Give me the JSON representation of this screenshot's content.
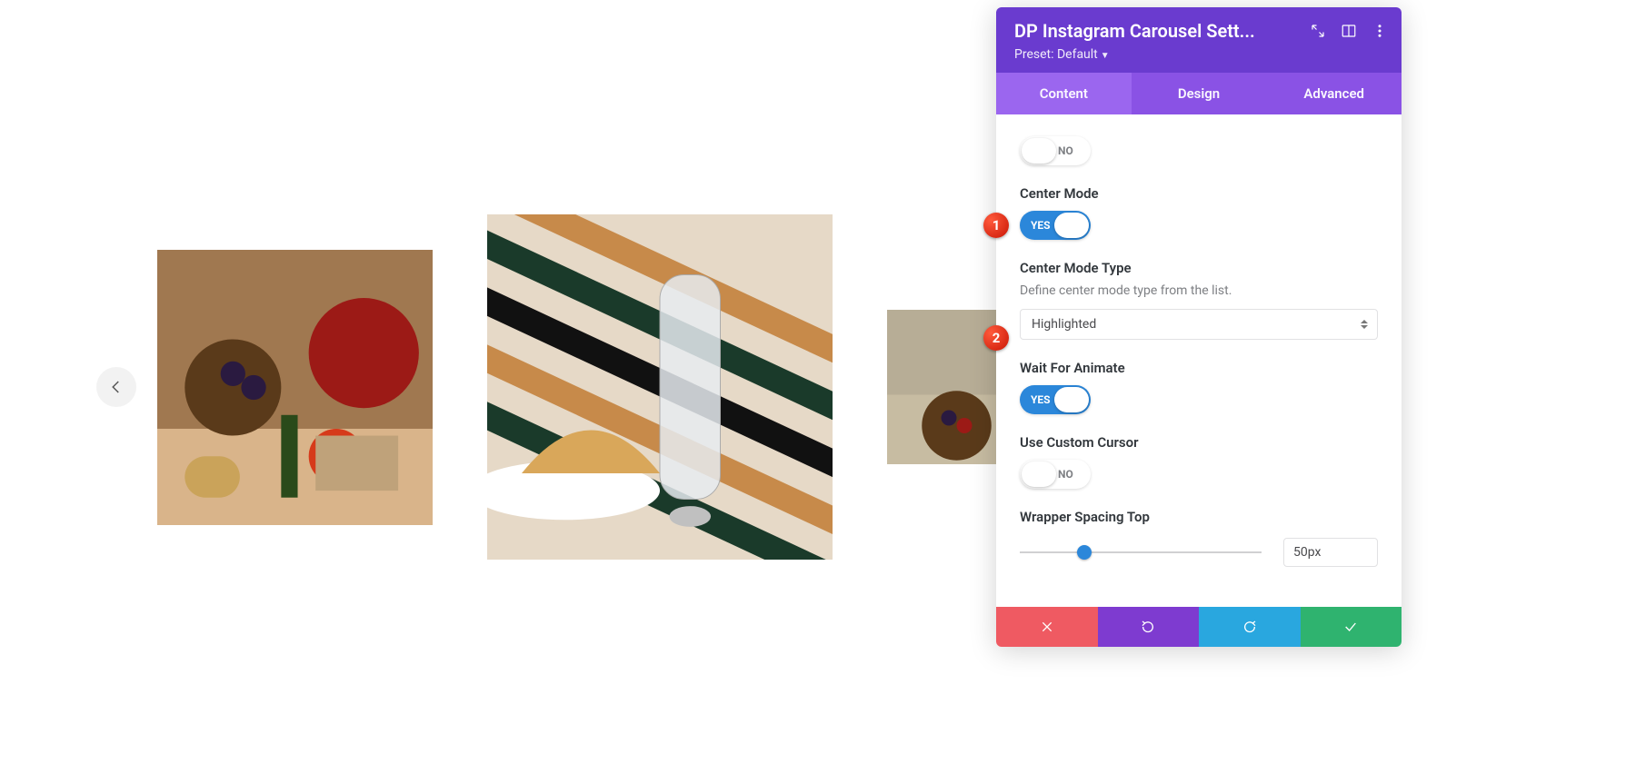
{
  "panel": {
    "title": "DP Instagram Carousel Sett...",
    "preset_label": "Preset: Default"
  },
  "tabs": {
    "content": "Content",
    "design": "Design",
    "advanced": "Advanced",
    "active": "content"
  },
  "fields": {
    "prev_toggle": {
      "state": "off",
      "text": "NO"
    },
    "center_mode": {
      "label": "Center Mode",
      "state": "on",
      "text": "YES"
    },
    "center_mode_type": {
      "label": "Center Mode Type",
      "desc": "Define center mode type from the list.",
      "value": "Highlighted"
    },
    "wait_for_animate": {
      "label": "Wait For Animate",
      "state": "on",
      "text": "YES"
    },
    "use_custom_cursor": {
      "label": "Use Custom Cursor",
      "state": "off",
      "text": "NO"
    },
    "wrapper_spacing_top": {
      "label": "Wrapper Spacing Top",
      "value": "50px",
      "slider": 50,
      "min": 0,
      "max": 200
    }
  },
  "badges": {
    "b1": "1",
    "b2": "2"
  }
}
